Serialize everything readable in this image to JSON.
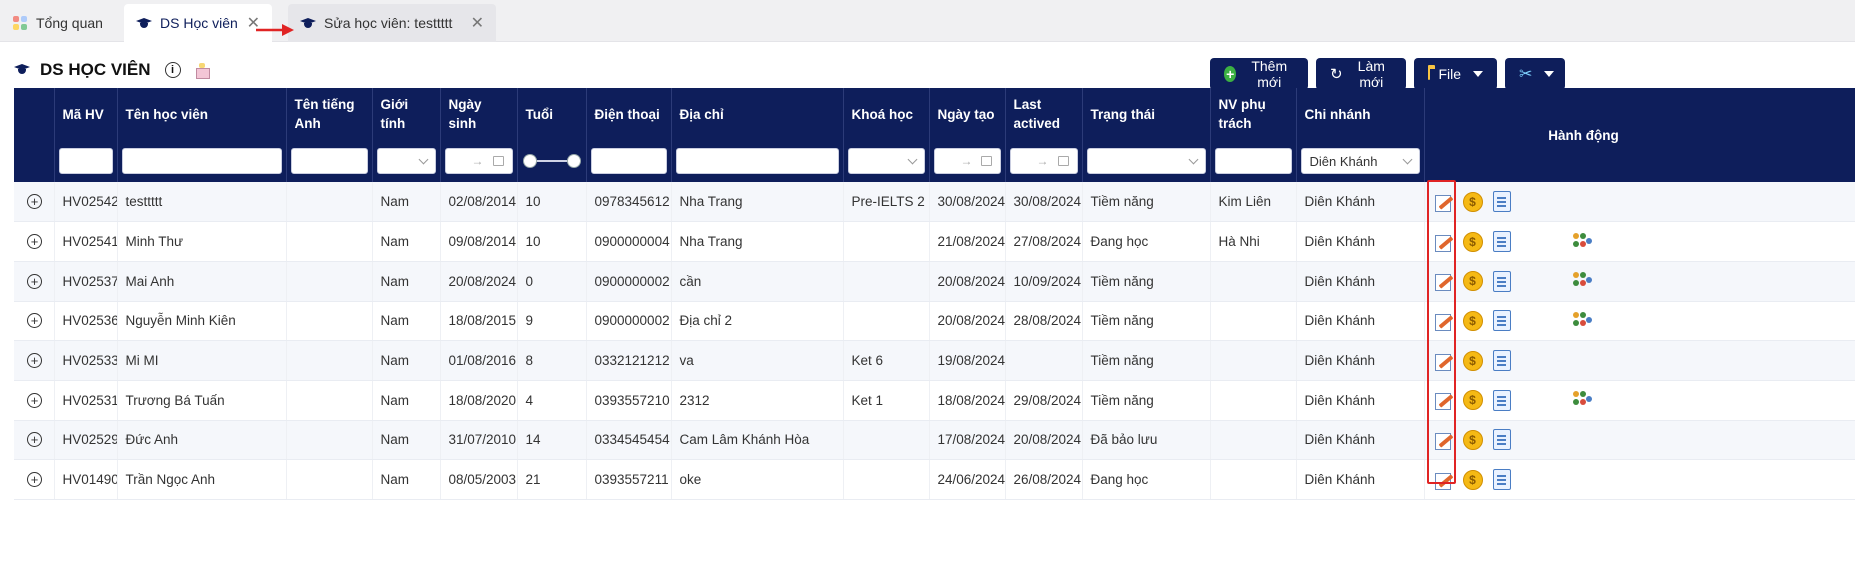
{
  "tabs": [
    {
      "label": "Tổng quan",
      "closable": false
    },
    {
      "label": "DS Học viên",
      "closable": true,
      "active": true
    },
    {
      "label": "Sửa học viên: testtttt",
      "closable": true
    }
  ],
  "page": {
    "title": "DS HỌC VIÊN"
  },
  "toolbar": {
    "add_label": "Thêm mới",
    "refresh_label": "Làm mới",
    "file_label": "File"
  },
  "table": {
    "headers": {
      "code": "Mã HV",
      "name": "Tên học viên",
      "english_name": "Tên tiếng Anh",
      "gender": "Giới tính",
      "dob": "Ngày sinh",
      "age": "Tuổi",
      "phone": "Điện thoại",
      "address": "Địa chỉ",
      "course": "Khoá học",
      "created": "Ngày tạo",
      "last_active": "Last actived",
      "status": "Trạng thái",
      "staff": "NV phụ trách",
      "branch": "Chi nhánh",
      "actions": "Hành động"
    },
    "filters": {
      "branch_value": "Diên Khánh",
      "date_arrow": "→"
    },
    "rows": [
      {
        "code": "HV02542",
        "name": "testtttt",
        "english_name": "",
        "gender": "Nam",
        "dob": "02/08/2014",
        "age": "10",
        "phone": "0978345612",
        "address": "Nha Trang",
        "course": "Pre-IELTS 2",
        "created": "30/08/2024",
        "last_active": "30/08/2024",
        "status": "Tiềm năng",
        "staff": "Kim Liên",
        "branch": "Diên Khánh",
        "group_icon": false
      },
      {
        "code": "HV02541",
        "name": "Minh Thư",
        "english_name": "",
        "gender": "Nam",
        "dob": "09/08/2014",
        "age": "10",
        "phone": "0900000004",
        "address": "Nha Trang",
        "course": "",
        "created": "21/08/2024",
        "last_active": "27/08/2024",
        "status": "Đang học",
        "staff": "Hà Nhi",
        "branch": "Diên Khánh",
        "group_icon": true
      },
      {
        "code": "HV02537",
        "name": "Mai Anh",
        "english_name": "",
        "gender": "Nam",
        "dob": "20/08/2024",
        "age": "0",
        "phone": "0900000002",
        "address": "cần",
        "course": "",
        "created": "20/08/2024",
        "last_active": "10/09/2024",
        "status": "Tiềm năng",
        "staff": "",
        "branch": "Diên Khánh",
        "group_icon": true
      },
      {
        "code": "HV02536",
        "name": "Nguyễn Minh Kiên",
        "english_name": "",
        "gender": "Nam",
        "dob": "18/08/2015",
        "age": "9",
        "phone": "0900000002",
        "address": "Địa chỉ 2",
        "course": "",
        "created": "20/08/2024",
        "last_active": "28/08/2024",
        "status": "Tiềm năng",
        "staff": "",
        "branch": "Diên Khánh",
        "group_icon": true
      },
      {
        "code": "HV02533",
        "name": "Mi MI",
        "english_name": "",
        "gender": "Nam",
        "dob": "01/08/2016",
        "age": "8",
        "phone": "0332121212",
        "address": "va",
        "course": "Ket 6",
        "created": "19/08/2024",
        "last_active": "",
        "status": "Tiềm năng",
        "staff": "",
        "branch": "Diên Khánh",
        "group_icon": false
      },
      {
        "code": "HV02531",
        "name": "Trương Bá Tuấn",
        "english_name": "",
        "gender": "Nam",
        "dob": "18/08/2020",
        "age": "4",
        "phone": "0393557210",
        "address": "2312",
        "course": "Ket 1",
        "created": "18/08/2024",
        "last_active": "29/08/2024",
        "status": "Tiềm năng",
        "staff": "",
        "branch": "Diên Khánh",
        "group_icon": true
      },
      {
        "code": "HV02529",
        "name": "Đức Anh",
        "english_name": "",
        "gender": "Nam",
        "dob": "31/07/2010",
        "age": "14",
        "phone": "0334545454",
        "address": "Cam Lâm Khánh Hòa",
        "course": "",
        "created": "17/08/2024",
        "last_active": "20/08/2024",
        "status": "Đã bảo lưu",
        "staff": "",
        "branch": "Diên Khánh",
        "group_icon": false
      },
      {
        "code": "HV01490",
        "name": "Trần Ngọc Anh",
        "english_name": "",
        "gender": "Nam",
        "dob": "08/05/2003",
        "age": "21",
        "phone": "0393557211",
        "address": "oke",
        "course": "",
        "created": "24/06/2024",
        "last_active": "26/08/2024",
        "status": "Đang học",
        "staff": "",
        "branch": "Diên Khánh",
        "group_icon": false
      }
    ]
  },
  "colors": {
    "header_bg": "#0e1e5b",
    "accent_red": "#e02424",
    "coin": "#f5b915",
    "add_green": "#3cb043"
  },
  "icons": {
    "coin_symbol": "$"
  }
}
